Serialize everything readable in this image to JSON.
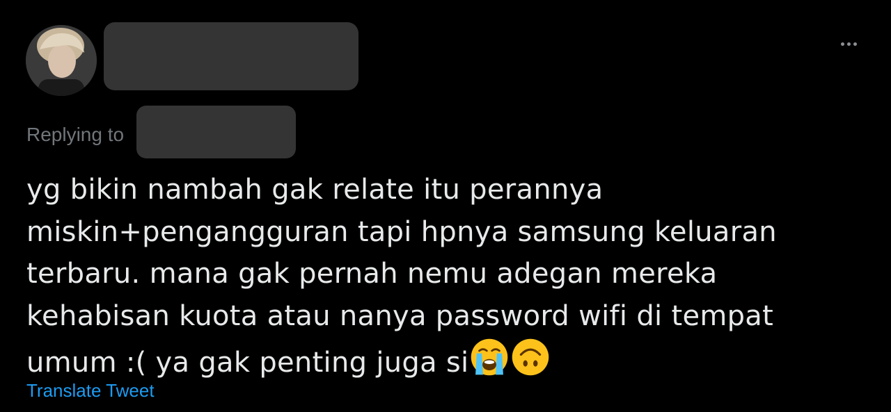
{
  "tweet": {
    "replying_label": "Replying to",
    "text_lines": [
      "yg bikin nambah gak relate itu perannya",
      "miskin+pengangguran tapi hpnya samsung keluaran",
      "terbaru. mana gak pernah nemu adegan mereka",
      "kehabisan kuota atau nanya password wifi di tempat",
      "umum :( ya gak penting juga si"
    ],
    "emojis": [
      "loudly-crying-face",
      "upside-down-face"
    ],
    "translate_label": "Translate Tweet"
  },
  "icons": {
    "more": "more-options-icon"
  },
  "colors": {
    "background": "#000000",
    "text": "#e7e9ea",
    "muted": "#71767b",
    "link": "#1d9bf0",
    "redaction": "#343434"
  }
}
